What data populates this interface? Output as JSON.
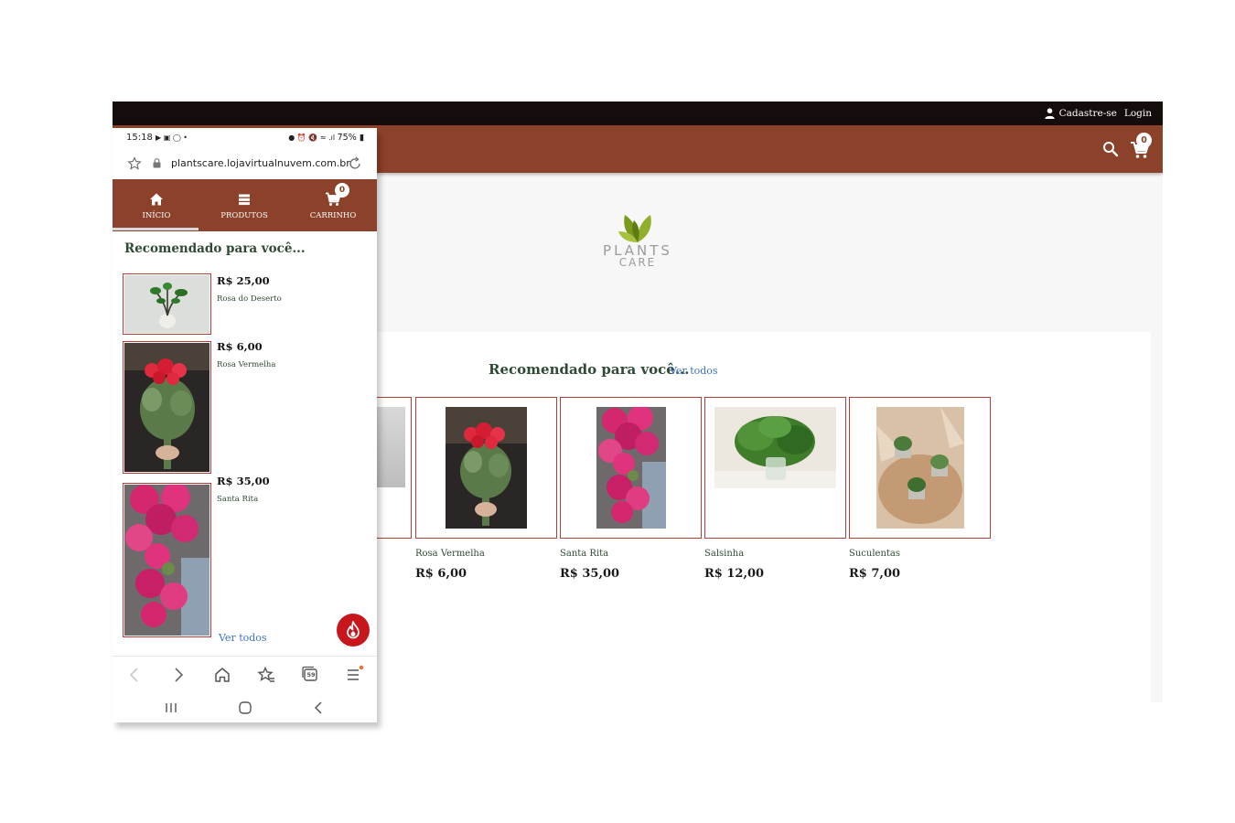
{
  "desktop": {
    "topbar": {
      "register_label": "Cadastre-se",
      "login_label": "Login"
    },
    "header": {
      "cart_count": "0"
    },
    "logo": {
      "line1": "PLANTS",
      "line2": "CARE"
    },
    "recommended": {
      "title": "Recomendado para você...",
      "see_all": "Ver todos",
      "products": [
        {
          "name": "Rosa Vermelha",
          "price": "R$ 6,00"
        },
        {
          "name": "Santa Rita",
          "price": "R$ 35,00"
        },
        {
          "name": "Salsinha",
          "price": "R$ 12,00"
        },
        {
          "name": "Suculentas",
          "price": "R$ 7,00"
        }
      ]
    }
  },
  "phone": {
    "status": {
      "time": "15:18",
      "battery": "75%"
    },
    "browser": {
      "url": "plantscare.lojavirtualnuvem.com.br"
    },
    "nav": {
      "home": "INÍCIO",
      "products": "PRODUTOS",
      "cart": "CARRINHO",
      "cart_count": "0"
    },
    "recommended": {
      "title": "Recomendado para você...",
      "see_all": "Ver todos",
      "products": [
        {
          "price": "R$ 25,00",
          "name": "Rosa do Deserto"
        },
        {
          "price": "R$ 6,00",
          "name": "Rosa Vermelha"
        },
        {
          "price": "R$ 35,00",
          "name": "Santa Rita"
        }
      ]
    },
    "browser_tabs_count": "59"
  },
  "colors": {
    "brand": "#8c412a",
    "topbar": "#140d0b",
    "card_border": "#b53d35",
    "title_green": "#2e4a34",
    "link": "#3d72c4",
    "fab": "#c8161d"
  }
}
